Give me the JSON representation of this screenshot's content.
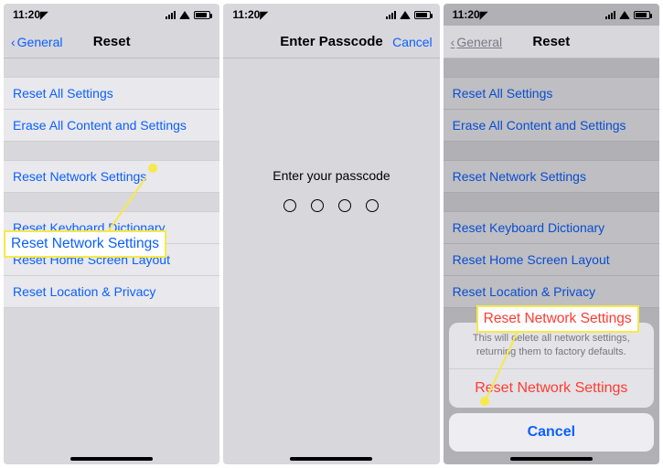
{
  "statusbar": {
    "time": "11:20"
  },
  "screen1": {
    "back_label": "General",
    "title": "Reset",
    "items": {
      "reset_all": "Reset All Settings",
      "erase_all": "Erase All Content and Settings",
      "reset_network": "Reset Network Settings",
      "reset_keyboard": "Reset Keyboard Dictionary",
      "reset_home": "Reset Home Screen Layout",
      "reset_location": "Reset Location & Privacy"
    },
    "callout": "Reset Network Settings"
  },
  "screen2": {
    "title": "Enter Passcode",
    "cancel": "Cancel",
    "prompt": "Enter your passcode"
  },
  "screen3": {
    "back_label": "General",
    "title": "Reset",
    "items": {
      "reset_all": "Reset All Settings",
      "erase_all": "Erase All Content and Settings",
      "reset_network": "Reset Network Settings",
      "reset_keyboard": "Reset Keyboard Dictionary",
      "reset_home": "Reset Home Screen Layout",
      "reset_location": "Reset Location & Privacy"
    },
    "sheet": {
      "message": "This will delete all network settings, returning them to factory defaults.",
      "action": "Reset Network Settings",
      "cancel": "Cancel"
    },
    "callout": "Reset Network Settings"
  }
}
